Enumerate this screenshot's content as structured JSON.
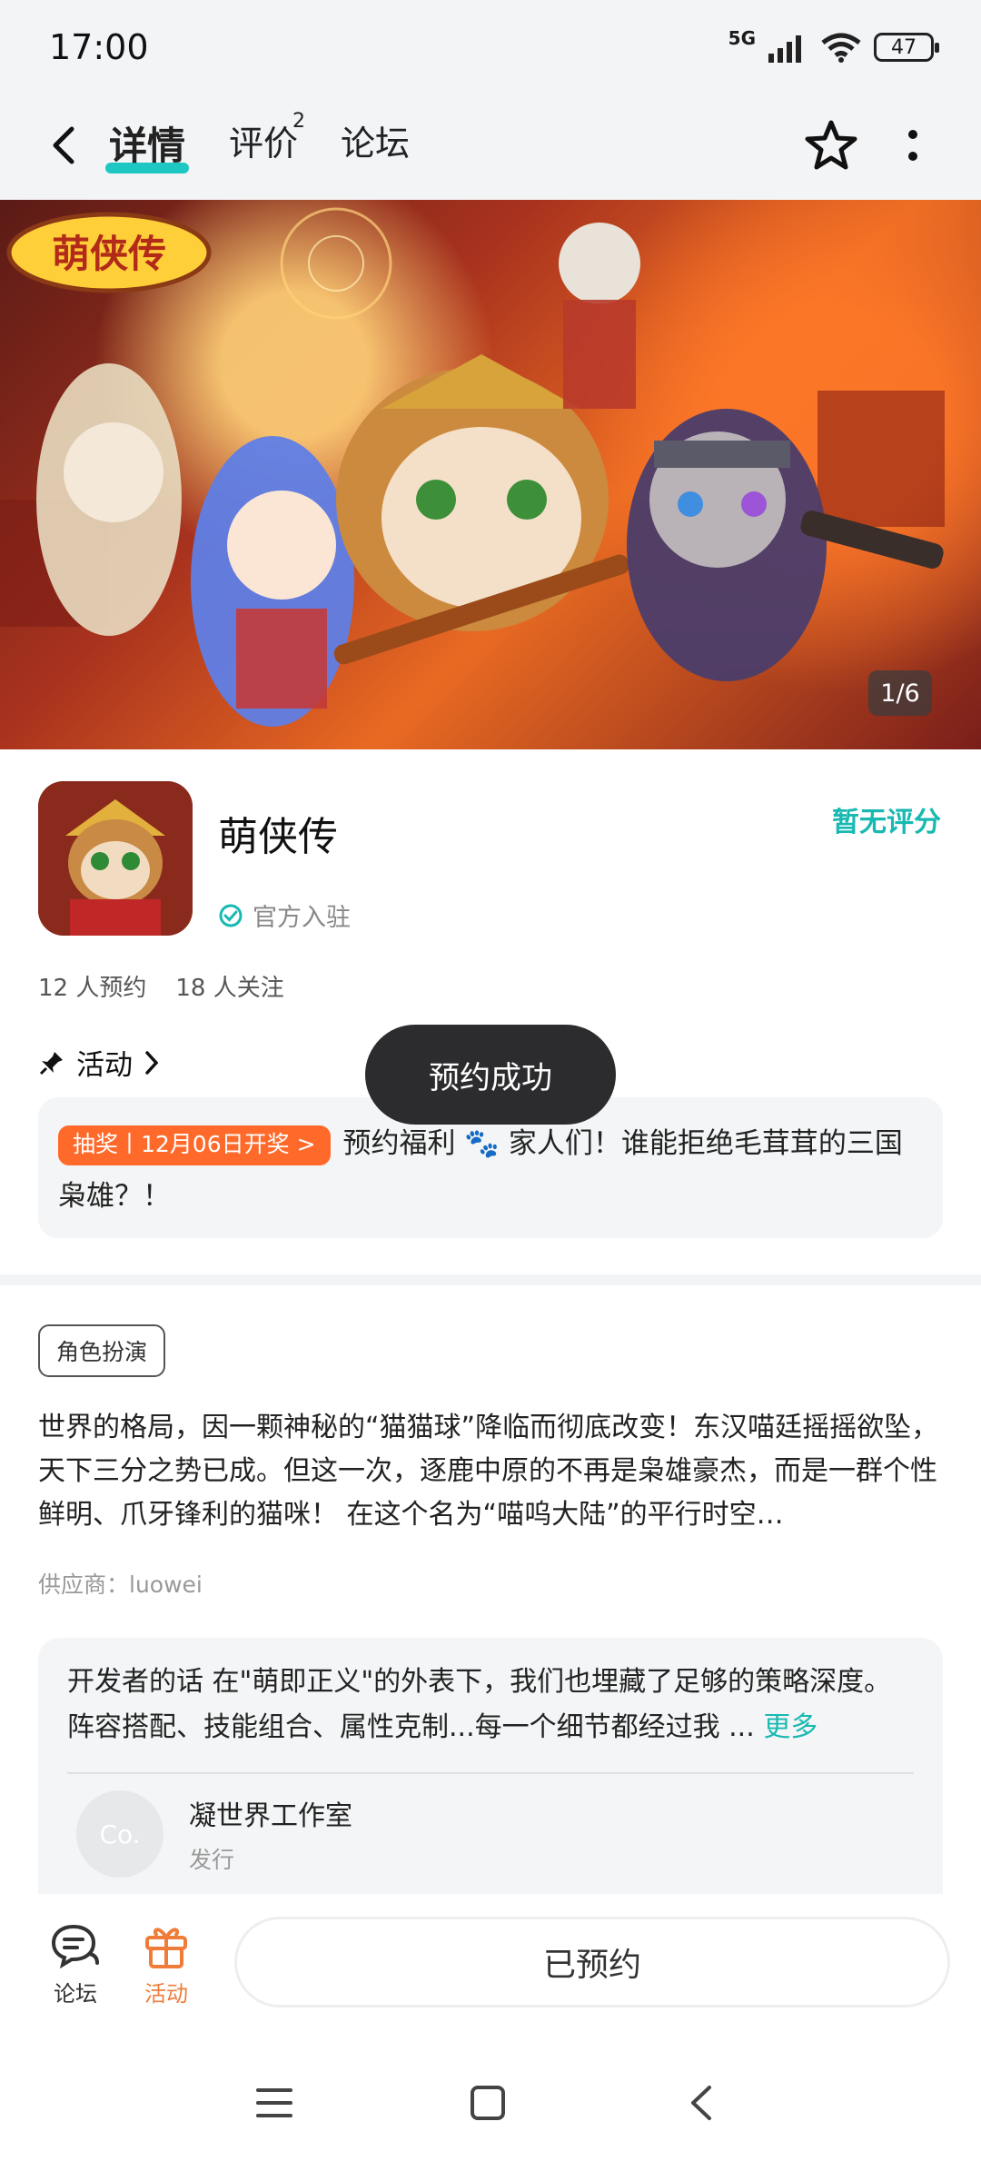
{
  "status_bar": {
    "time": "17:00",
    "network": "5G",
    "battery": "47"
  },
  "header": {
    "tabs": [
      {
        "label": "详情"
      },
      {
        "label": "评价",
        "badge": "2"
      },
      {
        "label": "论坛"
      }
    ]
  },
  "banner": {
    "title_logo": "萌侠传",
    "page_indicator": "1/6"
  },
  "app": {
    "name": "萌侠传",
    "official_label": "官方入驻",
    "rating": "暂无评分",
    "reservations": "12 人预约",
    "followers": "18 人关注"
  },
  "activity": {
    "title": "活动",
    "tag": "抽奖丨12月06日开奖 >",
    "text": "预约福利 🐾 家人们！谁能拒绝毛茸茸的三国枭雄？！"
  },
  "toast": "预约成功",
  "genre_tag": "角色扮演",
  "description": "世界的格局，因一颗神秘的“猫猫球”降临而彻底改变！东汉喵廷摇摇欲坠，天下三分之势已成。但这一次，逐鹿中原的不再是枭雄豪杰，而是一群个性鲜明、爪牙锋利的猫咪！ 在这个名为“喵呜大陆”的平行时空…",
  "supplier": "供应商：luowei",
  "developer": {
    "text": "开发者的话  在\"萌即正义\"的外表下，我们也埋藏了足够的策略深度。阵容搭配、技能组合、属性克制...每一个细节都经过我 ...",
    "more": "更多",
    "studio_avatar": "Co.",
    "studio_name": "凝世界工作室",
    "studio_role": "发行"
  },
  "bottom_bar": {
    "forum_label": "论坛",
    "activity_label": "活动",
    "reserved_button": "已预约"
  },
  "colors": {
    "accent": "#18b9b2",
    "orange": "#ff6a2b",
    "activity_orange": "#f07c3a"
  }
}
